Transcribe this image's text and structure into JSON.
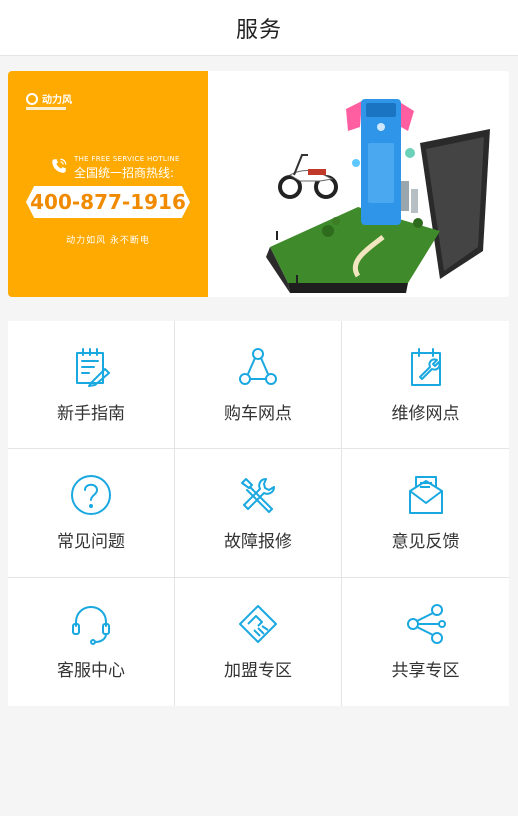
{
  "header": {
    "title": "服务"
  },
  "banner": {
    "hotline_en": "THE FREE SERVICE HOTLINE",
    "hotline_cn": "全国统一招商热线:",
    "phone": "400-877-1916",
    "slogan": "动力如风 永不断电",
    "brand_color": "#ffaa00"
  },
  "services": [
    {
      "label": "新手指南",
      "icon": "guide-document-icon"
    },
    {
      "label": "购车网点",
      "icon": "network-nodes-icon"
    },
    {
      "label": "维修网点",
      "icon": "wrench-clipboard-icon"
    },
    {
      "label": "常见问题",
      "icon": "question-circle-icon"
    },
    {
      "label": "故障报修",
      "icon": "tools-icon"
    },
    {
      "label": "意见反馈",
      "icon": "feedback-envelope-icon"
    },
    {
      "label": "客服中心",
      "icon": "headset-icon"
    },
    {
      "label": "加盟专区",
      "icon": "handshake-icon"
    },
    {
      "label": "共享专区",
      "icon": "share-icon"
    }
  ],
  "accent_color": "#1aa8e0"
}
